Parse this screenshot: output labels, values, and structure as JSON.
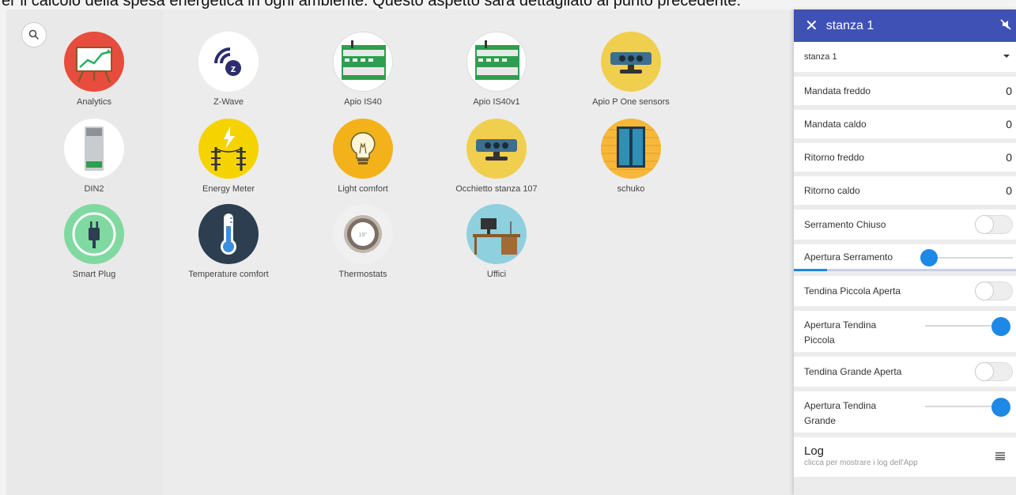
{
  "caption": "er il calcolo della spesa energetica in ogni ambiente. Questo aspetto sarà dettagliato al punto precedente.",
  "search": {
    "icon": "search-icon"
  },
  "apps": [
    {
      "label": "Analytics",
      "icon": "analytics-chart-icon",
      "color": "#e74c3c"
    },
    {
      "label": "Z-Wave",
      "icon": "z-wave-logo-icon",
      "color": "#ffffff"
    },
    {
      "label": "Apio IS40",
      "icon": "din-rail-module-icon",
      "color": "#ffffff"
    },
    {
      "label": "Apio IS40v1",
      "icon": "din-rail-module-icon",
      "color": "#ffffff"
    },
    {
      "label": "Apio P One sensors",
      "icon": "sensor-device-icon",
      "color": "#f0cf4e"
    },
    {
      "label": "DIN2",
      "icon": "din-device-icon",
      "color": "#ffffff"
    },
    {
      "label": "Energy Meter",
      "icon": "power-line-icon",
      "color": "#f5d300"
    },
    {
      "label": "Light comfort",
      "icon": "light-bulb-icon",
      "color": "#f3b21a"
    },
    {
      "label": "Occhietto stanza 107",
      "icon": "sensor-device-icon",
      "color": "#f0cf4e"
    },
    {
      "label": "schuko",
      "icon": "window-icon",
      "color": "#f7b83a"
    },
    {
      "label": "Smart Plug",
      "icon": "plug-icon",
      "color": "#80d9a0"
    },
    {
      "label": "Temperature comfort",
      "icon": "thermometer-icon",
      "color": "#2c3e50"
    },
    {
      "label": "Thermostats",
      "icon": "thermostat-dial-icon",
      "color": "#f0f0f0"
    },
    {
      "label": "Uffici",
      "icon": "office-desk-icon",
      "color": "#8fd0de"
    }
  ],
  "panel": {
    "title": "stanza 1",
    "close_icon": "close-icon",
    "mute_icon": "mute-icon",
    "select": {
      "value": "stanza 1"
    },
    "values": [
      {
        "label": "Mandata freddo",
        "value": "0"
      },
      {
        "label": "Mandata caldo",
        "value": "0"
      },
      {
        "label": "Ritorno freddo",
        "value": "0"
      },
      {
        "label": "Ritorno caldo",
        "value": "0"
      }
    ],
    "serramento_toggle": {
      "label": "Serramento Chiuso",
      "on": false
    },
    "apertura_serramento": {
      "label": "Apertura Serramento",
      "level": 0
    },
    "tendina_piccola_toggle": {
      "label": "Tendina Piccola Aperta",
      "on": false
    },
    "apertura_tendina_piccola": {
      "line1": "Apertura Tendina",
      "line2": "Piccola",
      "level": 1
    },
    "tendina_grande_toggle": {
      "label": "Tendina Grande Aperta",
      "on": false
    },
    "apertura_tendina_grande": {
      "line1": "Apertura Tendina",
      "line2": "Grande",
      "level": 1
    },
    "log": {
      "title": "Log",
      "subtitle": "clicca per mostrare i log dell'App",
      "icon": "menu-icon"
    }
  }
}
